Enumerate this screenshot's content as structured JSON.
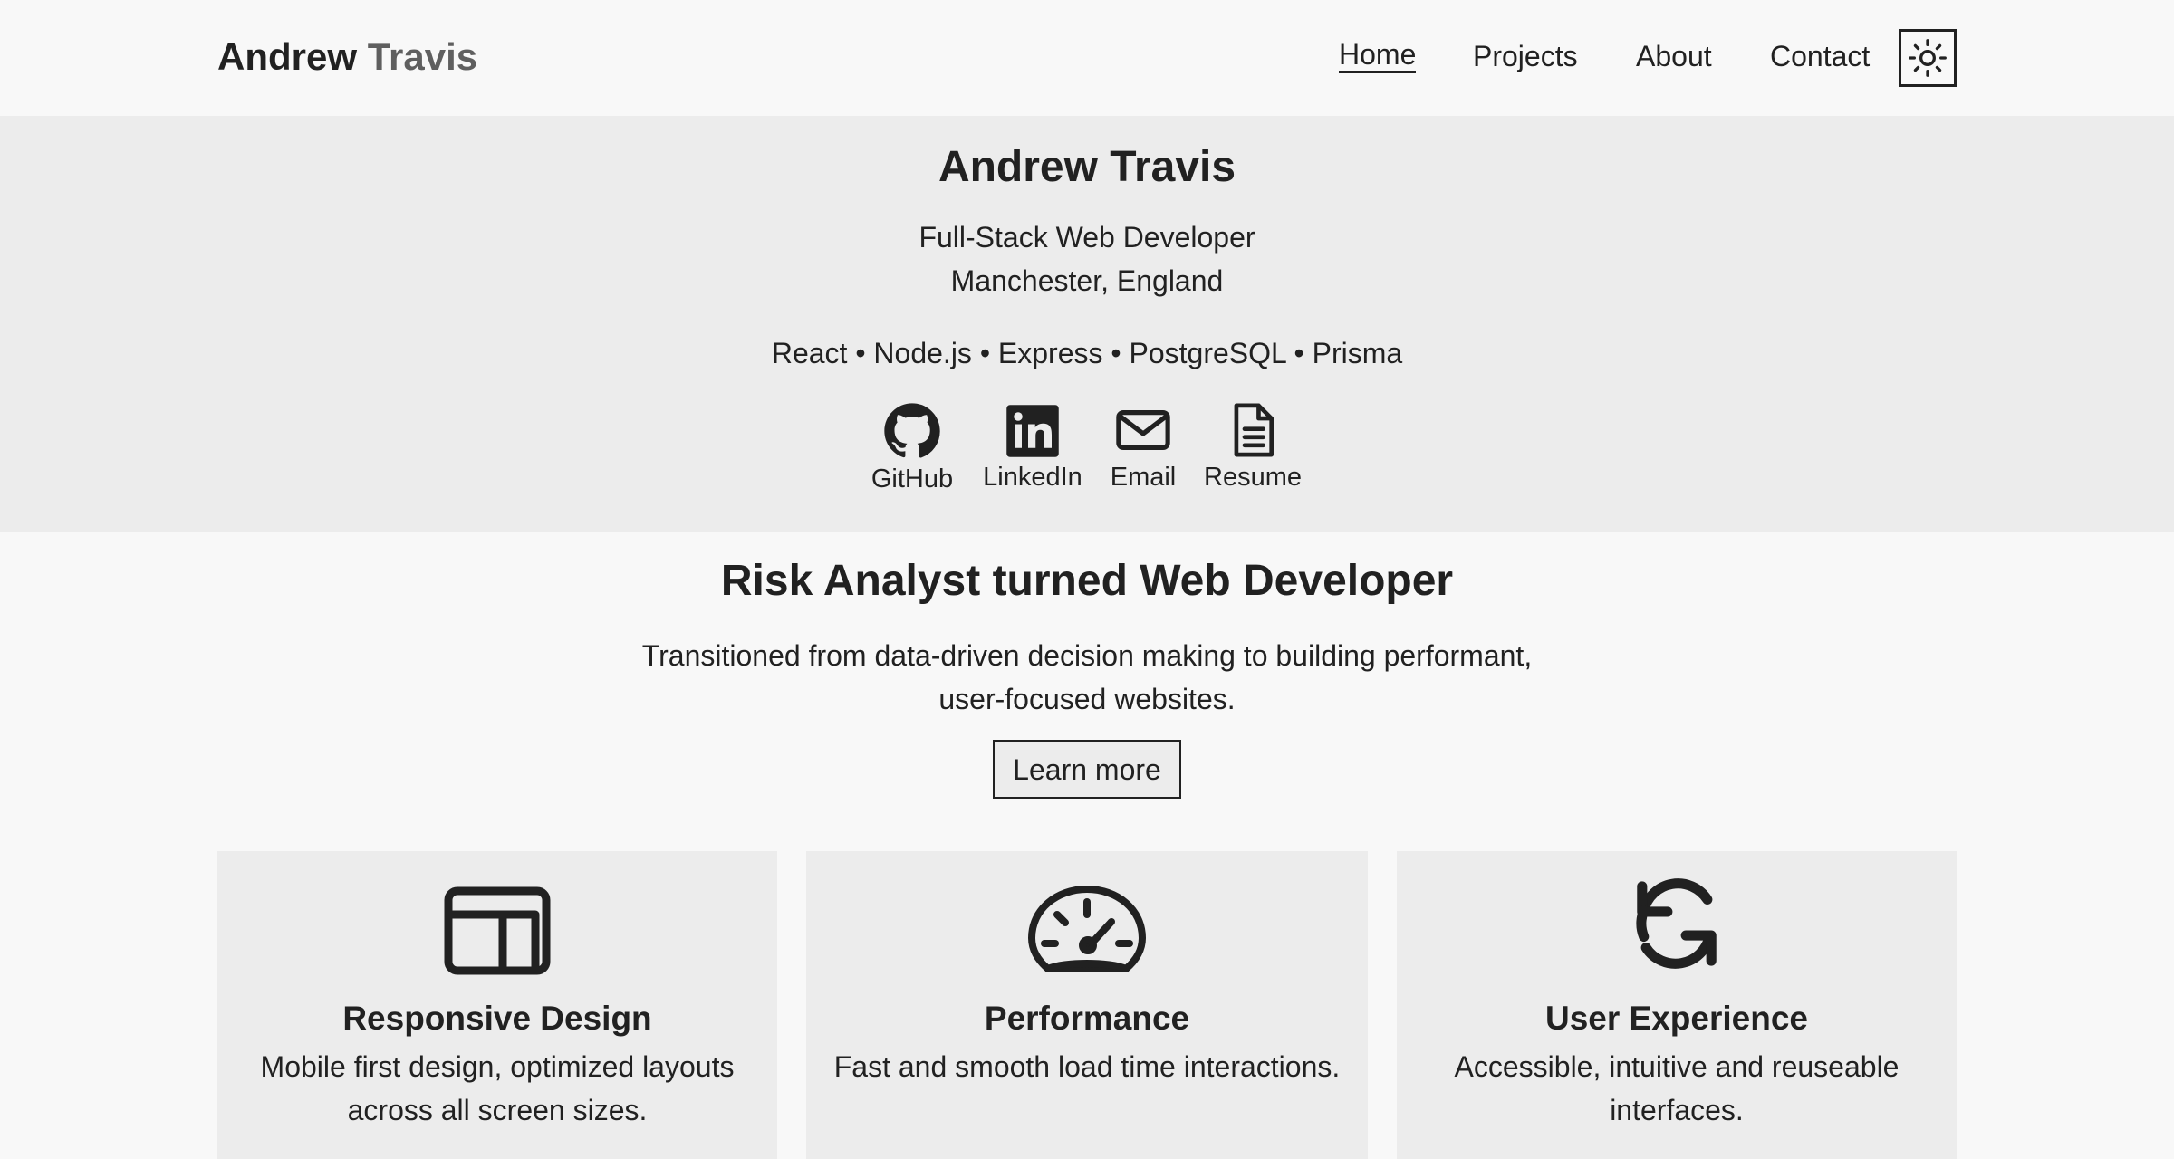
{
  "header": {
    "logo_first": "Andrew",
    "logo_last": "Travis",
    "nav": [
      {
        "label": "Home",
        "active": true
      },
      {
        "label": "Projects"
      },
      {
        "label": "About"
      },
      {
        "label": "Contact"
      }
    ],
    "theme_toggle_icon": "sun-icon"
  },
  "hero": {
    "name": "Andrew Travis",
    "role": "Full-Stack Web Developer",
    "location": "Manchester, England",
    "stack": "React • Node.js • Express • PostgreSQL • Prisma",
    "socials": [
      {
        "label": "GitHub",
        "icon": "github-icon"
      },
      {
        "label": "LinkedIn",
        "icon": "linkedin-icon"
      },
      {
        "label": "Email",
        "icon": "email-icon"
      },
      {
        "label": "Resume",
        "icon": "document-icon"
      }
    ]
  },
  "intro": {
    "title": "Risk Analyst turned Web Developer",
    "text": "Transitioned from data-driven decision making to building performant, user-focused websites.",
    "button": "Learn more"
  },
  "cards": [
    {
      "icon": "layout-icon",
      "title": "Responsive Design",
      "text": "Mobile first design, optimized layouts across all screen sizes."
    },
    {
      "icon": "speedometer-icon",
      "title": "Performance",
      "text": "Fast and smooth load time interactions."
    },
    {
      "icon": "refresh-icon",
      "title": "User Experience",
      "text": "Accessible, intuitive and reuseable interfaces."
    }
  ],
  "colors": {
    "background": "#f8f8f8",
    "panel": "#ececec",
    "text": "#212121",
    "muted": "#5f5f5f"
  }
}
